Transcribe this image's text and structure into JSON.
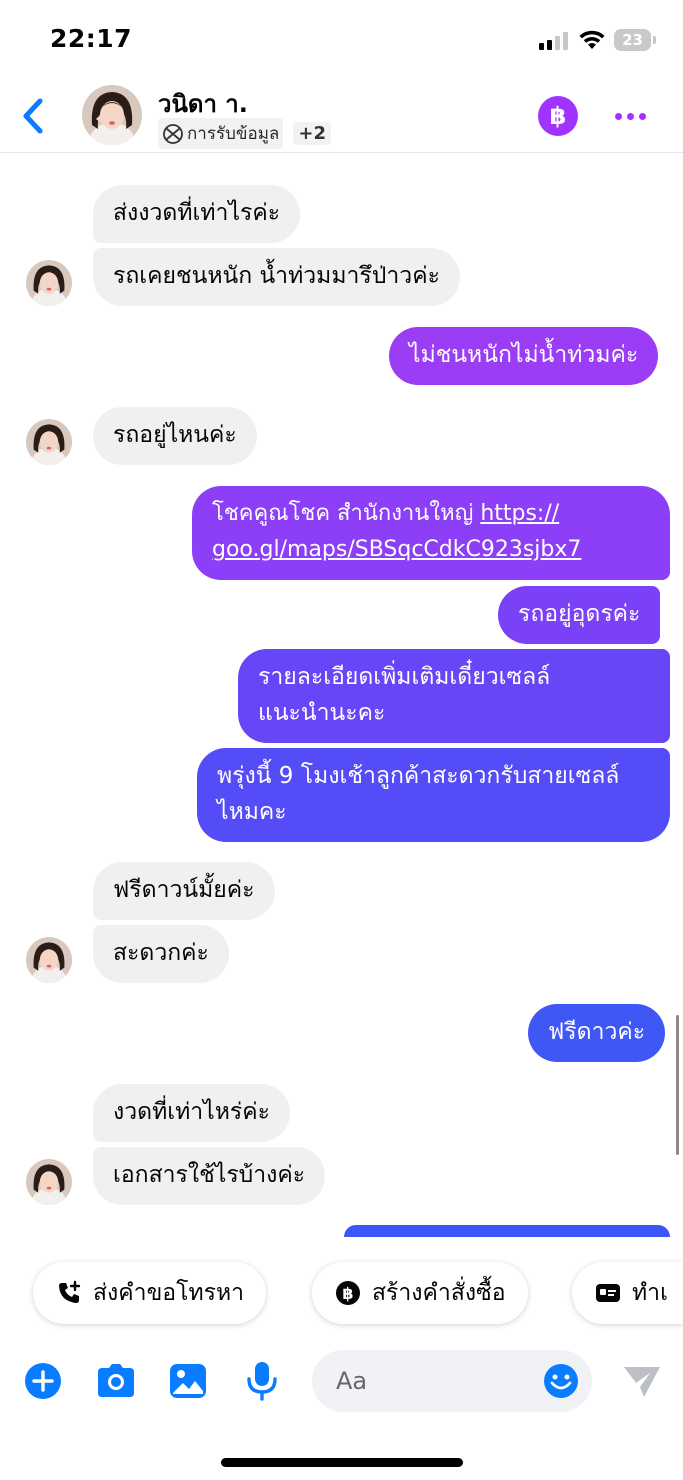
{
  "status_bar": {
    "time": "22:17",
    "battery": "23"
  },
  "header": {
    "contact_name": "วนิดา า.",
    "sub_label": "การรับข้อมูล",
    "extra_count": "+2"
  },
  "messages": [
    {
      "side": "in",
      "text": "ส่งงวดที่เท่าไรค่ะ"
    },
    {
      "side": "in",
      "text": "รถเคยชนหนัก น้ำท่วมมารึป่าวค่ะ"
    },
    {
      "side": "out",
      "text": "ไม่ชนหนักไม่น้ำท่วมค่ะ"
    },
    {
      "side": "in",
      "text": "รถอยู่ไหนค่ะ"
    },
    {
      "side": "out",
      "text_prefix": "โชคคูณโชค สำนักงานใหญ่ ",
      "link_line1": "https://",
      "link_line2": "goo.gl/maps/SBSqcCdkC923sjbx7"
    },
    {
      "side": "out",
      "text": "รถอยู่อุดรค่ะ"
    },
    {
      "side": "out",
      "line1": "รายละเอียดเพิ่มเติมเดี๋ยวเซลล์",
      "line2": "แนะนำนะคะ"
    },
    {
      "side": "out",
      "line1": "พรุ่งนี้ 9 โมงเช้าลูกค้าสะดวกรับสายเซลล์",
      "line2": "ไหมคะ"
    },
    {
      "side": "in",
      "text": "ฟรีดาวน์มั้ยค่ะ"
    },
    {
      "side": "in",
      "text": "สะดวกค่ะ"
    },
    {
      "side": "out",
      "text": "ฟรีดาวค่ะ"
    },
    {
      "side": "in",
      "text": "งวดที่เท่าไหร่ค่ะ"
    },
    {
      "side": "in",
      "text": "เอกสารใช้ไรบ้างค่ะ"
    }
  ],
  "quick_actions": [
    {
      "label": "ส่งคำขอโทรหา",
      "icon": "phone-plus-icon"
    },
    {
      "label": "สร้างคำสั่งซื้อ",
      "icon": "bitcoin-icon"
    },
    {
      "label": "ทำเ",
      "icon": "id-card-icon"
    }
  ],
  "composer": {
    "placeholder": "Aa"
  },
  "colors": {
    "accent": "#a033ff",
    "blue": "#0a7cff",
    "incoming_bubble": "#f0f0f0",
    "outgoing_top": "#9b3df5",
    "outgoing_bottom": "#3b57f5"
  }
}
